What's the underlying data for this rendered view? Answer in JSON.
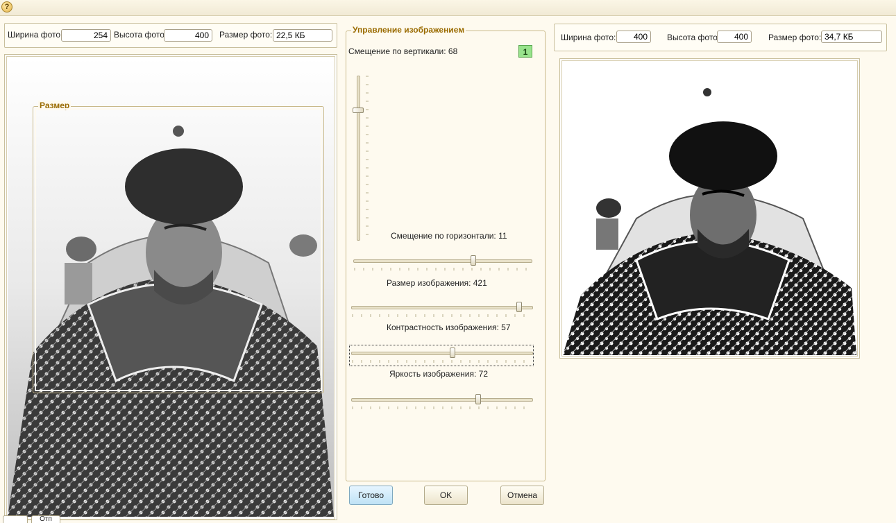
{
  "toolbar": {
    "help_label": "?"
  },
  "left_info": {
    "width_label": "Ширина фото:",
    "width_value": "254",
    "height_label": "Высота фото:",
    "height_value": "400",
    "size_label": "Размер фото:",
    "size_value": "22,5 КБ"
  },
  "left_photo": {
    "crop_title": "Размер"
  },
  "controls": {
    "title": "Управление изображением",
    "badge": "1",
    "vertical_label": "Смещение по вертикали: 68",
    "vertical_value": 68,
    "horizontal_label": "Смещение по горизонтали: 11",
    "horizontal_value": 11,
    "size_label": "Размер изображения: 421",
    "size_value": 421,
    "contrast_label": "Контрастность изображения: 57",
    "contrast_value": 57,
    "brightness_label": "Яркость изображения: 72",
    "brightness_value": 72
  },
  "buttons": {
    "done": "Готово",
    "ok": "OK",
    "cancel": "Отмена"
  },
  "right_info": {
    "width_label": "Ширина фото:",
    "width_value": "400",
    "height_label": "Высота фото:",
    "height_value": "400",
    "size_label": "Размер фото:",
    "size_value": "34,7 КБ"
  },
  "bottom_tabs": [
    "",
    "Отп"
  ]
}
